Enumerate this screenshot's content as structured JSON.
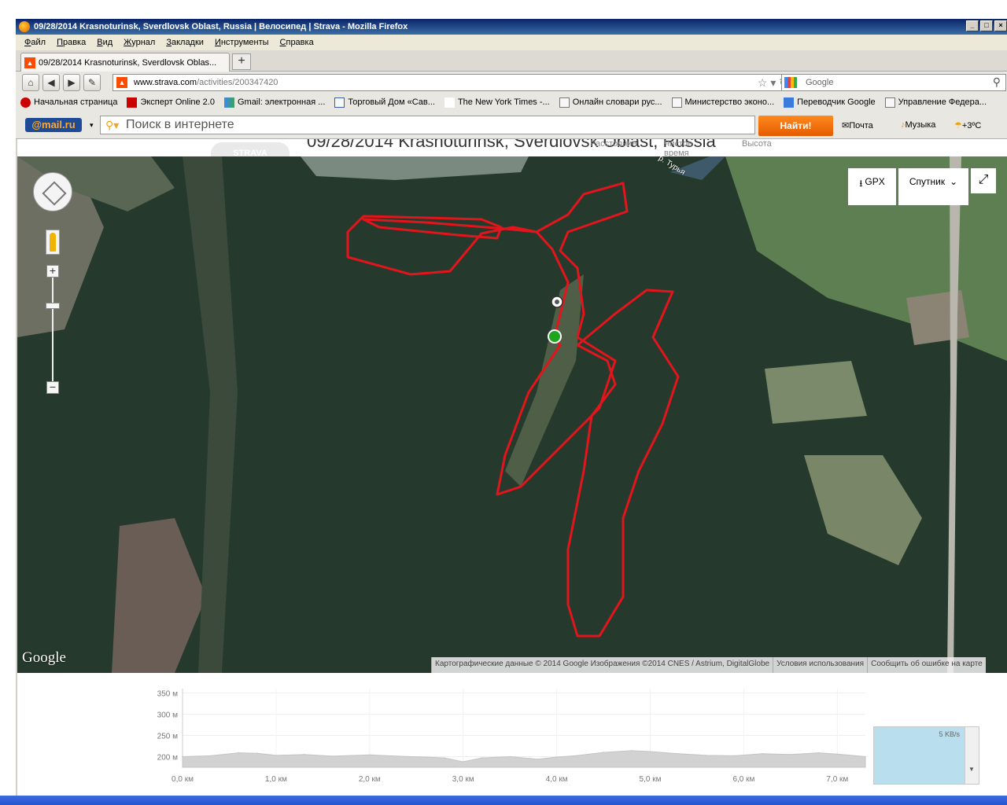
{
  "window": {
    "title": "09/28/2014 Krasnoturinsk, Sverdlovsk Oblast, Russia | Велосипед | Strava - Mozilla Firefox",
    "controls": [
      "_",
      "□",
      "×"
    ]
  },
  "menu": [
    "Файл",
    "Правка",
    "Вид",
    "Журнал",
    "Закладки",
    "Инструменты",
    "Справка"
  ],
  "tabs": [
    {
      "label": "09/28/2014 Krasnoturinsk, Sverdlovsk Oblas..."
    }
  ],
  "newtab_label": "+",
  "nav": {
    "url_host": "www.strava.com",
    "url_path": "/activities/200347420",
    "search_placeholder": "Google"
  },
  "bookmarks": [
    "Начальная страница",
    "Эксперт Online 2.0",
    "Gmail: электронная ...",
    "Торговый Дом «Сав...",
    "The New York Times -...",
    "Онлайн словари рус...",
    "Министерство эконо...",
    "Переводчик Google",
    "Управление Федера..."
  ],
  "mailru": {
    "logo": "@mail.ru",
    "search_placeholder": "Поиск в интернете",
    "find_label": "Найти!",
    "mail_label": "Почта",
    "music_label": "Музыка",
    "weather": "+3ºC"
  },
  "page": {
    "logo": "STRAVA",
    "title": "09/28/2014 Krasnoturinsk, Sverdlovsk Oblast, Russia",
    "stats": [
      "Расстояние",
      "Чистое время",
      "Высота"
    ]
  },
  "map": {
    "gpx_label": "GPX",
    "type_label": "Спутник",
    "river_label": "р. Турья",
    "google_logo": "Google",
    "attribution": [
      "Картографические данные © 2014 Google Изображения ©2014 CNES / Astrium, DigitalGlobe",
      "Условия использования",
      "Сообщить об ошибке на карте"
    ],
    "route_color": "#e3151c"
  },
  "chart_data": {
    "type": "area",
    "title": "",
    "xlabel": "",
    "ylabel": "",
    "y_tick_labels": [
      "350 м",
      "300 м",
      "250 м",
      "200 м"
    ],
    "x_tick_labels": [
      "0,0 км",
      "1,0 км",
      "2,0 км",
      "3,0 км",
      "4,0 км",
      "5,0 км",
      "6,0 км",
      "7,0 км"
    ],
    "ylim": [
      175,
      360
    ],
    "xlim": [
      0,
      7.3
    ],
    "x": [
      0,
      0.3,
      0.6,
      0.8,
      1.0,
      1.3,
      1.6,
      2.0,
      2.3,
      2.6,
      2.8,
      3.0,
      3.2,
      3.5,
      3.8,
      4.0,
      4.2,
      4.5,
      4.8,
      5.0,
      5.3,
      5.6,
      5.9,
      6.2,
      6.5,
      6.8,
      7.0,
      7.3
    ],
    "series": [
      {
        "values": [
          200,
          202,
          209,
          208,
          203,
          205,
          201,
          204,
          201,
          199,
          197,
          188,
          197,
          200,
          194,
          199,
          202,
          210,
          214,
          212,
          207,
          203,
          202,
          207,
          205,
          209,
          206,
          200
        ]
      }
    ]
  },
  "netmeter": {
    "label": "5 KB/s"
  }
}
